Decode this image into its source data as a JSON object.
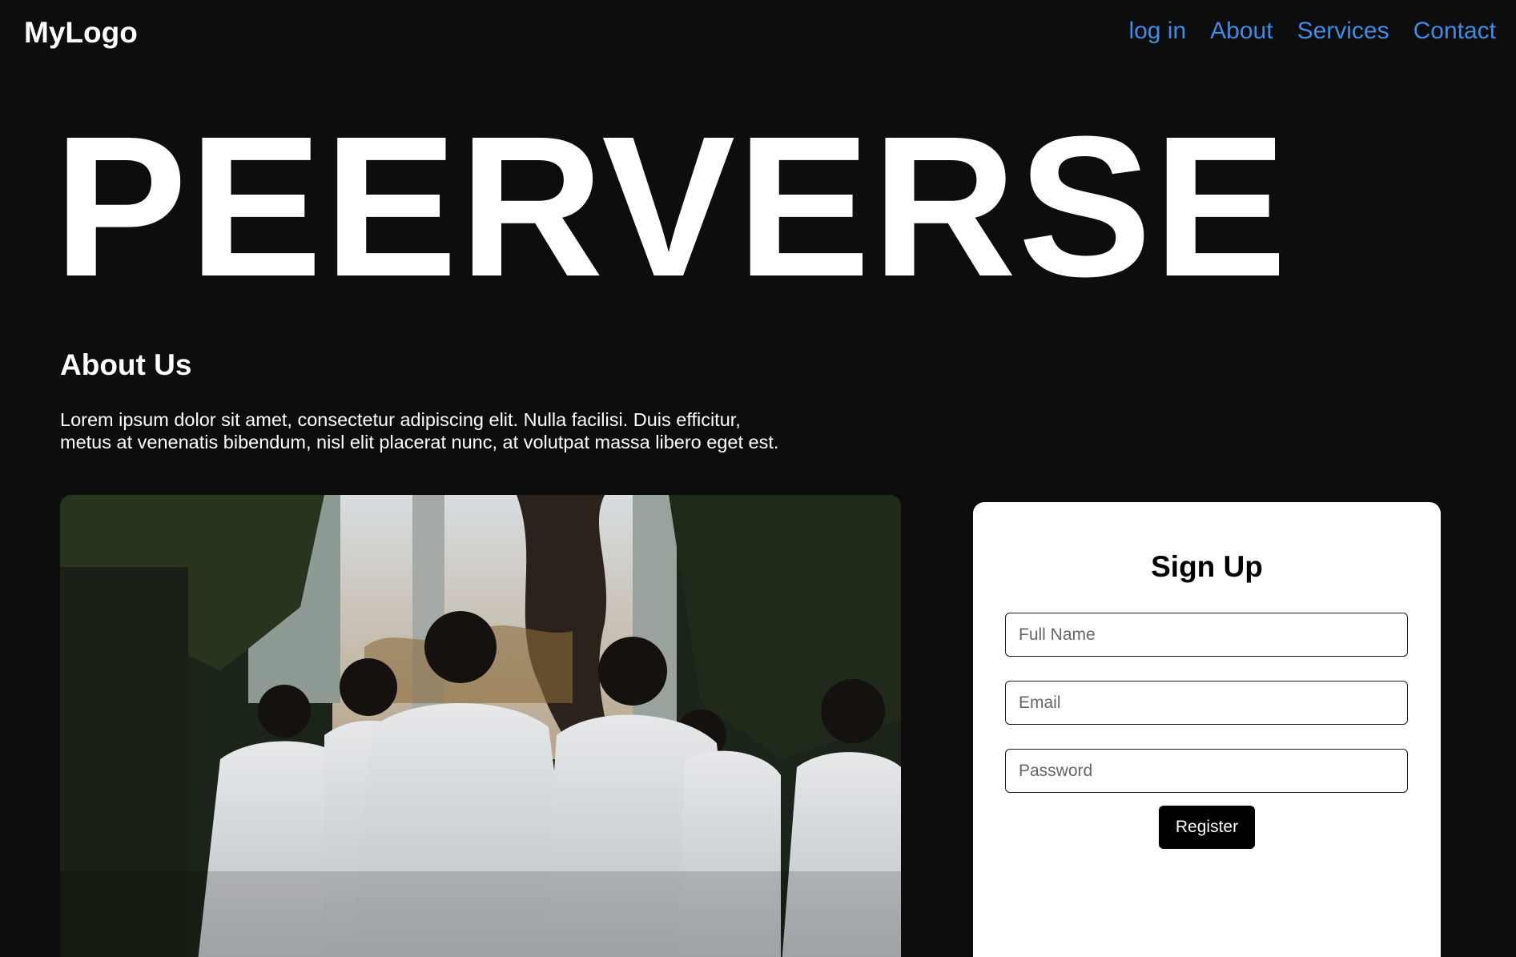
{
  "header": {
    "logo": "MyLogo",
    "nav": [
      {
        "label": "log in"
      },
      {
        "label": "About"
      },
      {
        "label": "Services"
      },
      {
        "label": "Contact"
      }
    ]
  },
  "hero": {
    "title": "PEERVERSE"
  },
  "about": {
    "title": "About Us",
    "text": "Lorem ipsum dolor sit amet, consectetur adipiscing elit. Nulla facilisi. Duis efficitur, metus at venenatis bibendum, nisl elit placerat nunc, at volutpat massa libero eget est."
  },
  "signup": {
    "title": "Sign Up",
    "full_name_placeholder": "Full Name",
    "email_placeholder": "Email",
    "password_placeholder": "Password",
    "register_label": "Register"
  },
  "colors": {
    "background": "#0d0d0d",
    "nav_link": "#3d8de6",
    "card": "#ffffff",
    "button": "#000000"
  }
}
